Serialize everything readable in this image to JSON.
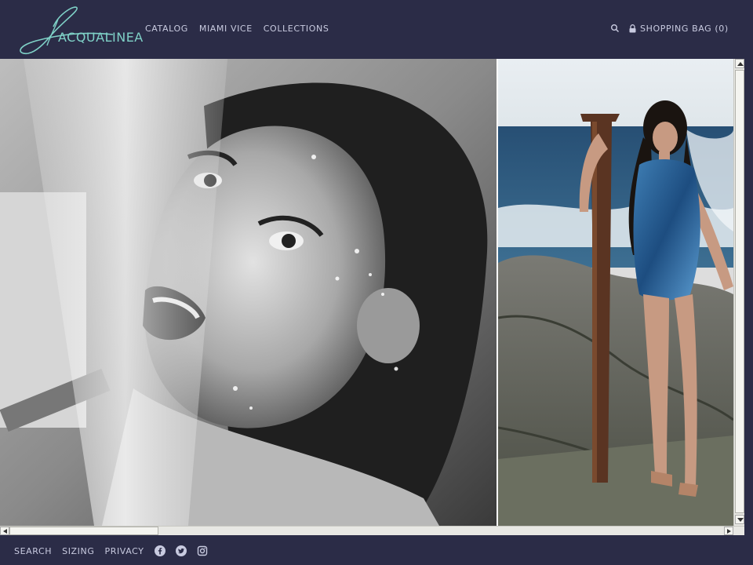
{
  "brand": {
    "logo_text": "ACQUALINEA"
  },
  "nav": {
    "items": [
      {
        "label": "CATALOG"
      },
      {
        "label": "MIAMI VICE"
      },
      {
        "label": "COLLECTIONS"
      }
    ]
  },
  "header": {
    "search_icon": "search-icon",
    "bag_label": "SHOPPING BAG (0)"
  },
  "hero": {
    "left_image": "black-and-white portrait of woman under water stream",
    "right_image": "woman in blue swimsuit on rocky shore by wooden post"
  },
  "footer": {
    "links": [
      {
        "label": "SEARCH"
      },
      {
        "label": "SIZING"
      },
      {
        "label": "PRIVACY"
      }
    ],
    "social": [
      "facebook-icon",
      "twitter-icon",
      "instagram-icon"
    ]
  },
  "colors": {
    "header_bg": "#2b2c47",
    "accent": "#7fd1c7",
    "nav_text": "#c9cbe0"
  }
}
